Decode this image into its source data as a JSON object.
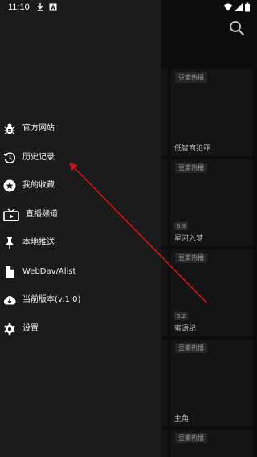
{
  "status_bar": {
    "time": "11:10",
    "icons": [
      "download-icon",
      "sim-a-icon",
      "wifi-icon",
      "signal-icon",
      "battery-icon"
    ]
  },
  "header": {
    "search_icon": "search-icon"
  },
  "drawer": {
    "items": [
      {
        "label": "官方网站",
        "icon": "bug-icon"
      },
      {
        "label": "历史记录",
        "icon": "history-icon"
      },
      {
        "label": "我的收藏",
        "icon": "star-icon"
      },
      {
        "label": "直播频道",
        "icon": "tv-icon"
      },
      {
        "label": "本地推送",
        "icon": "pin-icon"
      },
      {
        "label": "WebDav/Alist",
        "icon": "file-icon"
      },
      {
        "label": "当前版本(v:1.0)",
        "icon": "cloud-download-icon"
      },
      {
        "label": "设置",
        "icon": "gear-icon"
      }
    ]
  },
  "cards": [
    {
      "badge": "豆瓣热播",
      "rating": "",
      "title": "低智商犯罪"
    },
    {
      "badge": "豆瓣热播",
      "rating": "6.9",
      "title": "星河入梦"
    },
    {
      "badge": "豆瓣热播",
      "rating": "5.2",
      "title": "蜜语纪"
    },
    {
      "badge": "豆瓣热播",
      "rating": "",
      "title": "主角"
    },
    {
      "badge": "豆瓣热播",
      "rating": "",
      "title": ""
    }
  ],
  "colors": {
    "drawer_bg": "#1b1b1b",
    "content_bg": "#0c0c0c",
    "card_bg": "#141414",
    "text": "#f0f0f0",
    "annotation_arrow": "#d0121b"
  }
}
